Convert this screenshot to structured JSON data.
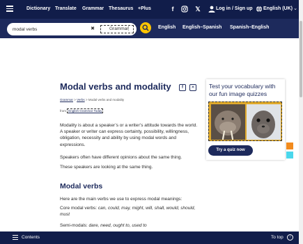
{
  "colors": {
    "nav_bg": "#111d4a",
    "search_bg": "#1d2a5c",
    "accent_yellow": "#fec400",
    "heading_blue": "#1d2a5c"
  },
  "nav": {
    "menu_icon": "hamburger-icon",
    "items": [
      "Dictionary",
      "Translate",
      "Grammar",
      "Thesaurus",
      "+Plus"
    ],
    "login_label": "Log in / Sign up",
    "language_label": "English (UK)",
    "icons": [
      "facebook-icon",
      "instagram-icon",
      "x-icon",
      "user-icon",
      "globe-icon",
      "chevron-down-icon"
    ]
  },
  "search": {
    "value": "modal verbs",
    "dictionary": "Grammar",
    "lang_links": [
      "English",
      "English–Spanish",
      "Spanish–English"
    ]
  },
  "article": {
    "title": "Modal verbs and modality",
    "breadcrumb": [
      "Grammar",
      "Verbs",
      "Modal verbs and modality"
    ],
    "from_prefix": "from",
    "from_link": "English Grammar Today",
    "paragraphs": [
      "Modality is about a speaker’s or a writer’s attitude towards the world. A speaker or writer can express certainty, possibility, willingness, obligation, necessity and ability by using modal words and expressions.",
      "Speakers often have different opinions about the same thing.",
      "These speakers are looking at the same thing."
    ],
    "section_heading": "Modal verbs",
    "section_intro": "Here are the main verbs we use to express modal meanings:",
    "core_label": "Core modal verbs: ",
    "core_verbs": "can, could, may, might, will, shall, would, should, must",
    "semi_label": "Semi-modals: ",
    "semi_verbs": "dare, need, ought to, used to"
  },
  "quiz": {
    "title": "Test your vocabulary with our fun image quizzes",
    "button": "Try a quiz now"
  },
  "bottom": {
    "contents_label": "Contents",
    "to_top_label": "To top"
  }
}
